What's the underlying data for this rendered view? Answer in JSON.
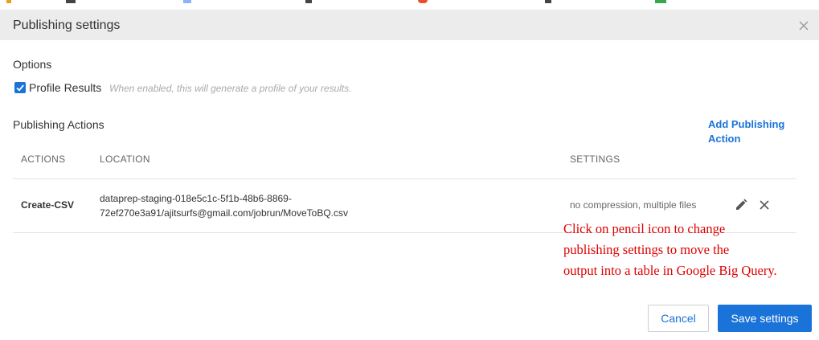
{
  "dialog": {
    "title": "Publishing settings",
    "close_icon": "close-icon"
  },
  "options": {
    "label": "Options",
    "profile_results": {
      "label": "Profile Results",
      "checked": true,
      "hint": "When enabled, this will generate a profile of your results."
    }
  },
  "publishing_actions": {
    "label": "Publishing Actions",
    "add_action_label": "Add Publishing Action",
    "columns": [
      "ACTIONS",
      "LOCATION",
      "SETTINGS"
    ],
    "rows": [
      {
        "action": "Create-CSV",
        "location_line1": "dataprep-staging-018e5c1c-5f1b-48b6-8869-",
        "location_line2": "72ef270e3a91/ajitsurfs@gmail.com/jobrun/MoveToBQ.csv",
        "settings": "no compression, multiple files",
        "edit_icon": "pencil-icon",
        "delete_icon": "close-icon"
      }
    ]
  },
  "annotation": {
    "line1": "Click on pencil icon to change",
    "line2": "publishing settings to move the",
    "line3": "output into a table in Google Big Query."
  },
  "footer": {
    "cancel_label": "Cancel",
    "save_label": "Save settings"
  },
  "colors": {
    "accent": "#1a73d9",
    "header_bg": "#ececec",
    "annotation": "#e00000"
  }
}
